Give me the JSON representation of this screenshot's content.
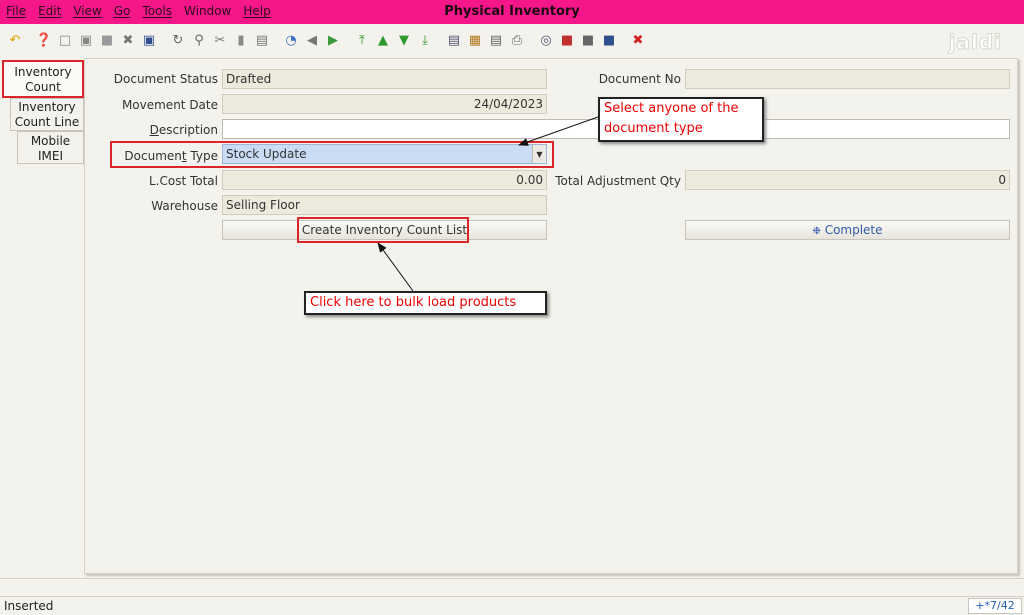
{
  "window": {
    "title": "Physical Inventory"
  },
  "menu": [
    {
      "label": "File",
      "u": true
    },
    {
      "label": "Edit",
      "u": true
    },
    {
      "label": "View",
      "u": true
    },
    {
      "label": "Go",
      "u": true
    },
    {
      "label": "Tools",
      "u": true
    },
    {
      "label": "Window",
      "u": false
    },
    {
      "label": "Help",
      "u": true
    }
  ],
  "toolbar_icons": [
    "undo-icon",
    "help-icon",
    "new-icon",
    "copy-icon",
    "delete-icon",
    "delete-selection-icon",
    "save-icon",
    "refresh-icon",
    "find-icon",
    "attachment-icon",
    "chat-icon",
    "history-icon",
    "home-icon",
    "back-icon",
    "forward-icon",
    "first-record-icon",
    "previous-record-icon",
    "next-record-icon",
    "last-record-icon",
    "report-icon",
    "archive-icon",
    "print-preview-icon",
    "print-icon",
    "zoom-across-icon",
    "active-workflows-icon",
    "requests-icon",
    "product-info-icon",
    "close-window-icon"
  ],
  "logo": "jaldi",
  "tabs": {
    "inventory_count": "Inventory\nCount",
    "inventory_count_line": "Inventory\nCount Line",
    "mobile_imei": "Mobile\nIMEI"
  },
  "form": {
    "document_status": {
      "label": "Document Status",
      "value": "Drafted"
    },
    "document_no": {
      "label": "Document No",
      "value": ""
    },
    "movement_date": {
      "label": "Movement Date",
      "value": "24/04/2023"
    },
    "description": {
      "label": "Description",
      "value": ""
    },
    "document_type": {
      "label": "Document Type",
      "value": "Stock Update"
    },
    "lcost_total": {
      "label": "L.Cost Total",
      "value": "0.00"
    },
    "total_adjustment_qty": {
      "label": "Total Adjustment Qty",
      "value": "0"
    },
    "warehouse": {
      "label": "Warehouse",
      "value": "Selling Floor"
    },
    "create_list_button": "Create Inventory Count List",
    "complete_button": "Complete"
  },
  "annotations": {
    "doc_type_callout": "Select anyone of the\ndocument type",
    "bulk_load_callout": "Click here to bulk load products"
  },
  "status": {
    "text": "Inserted",
    "record": "+*7/42"
  }
}
